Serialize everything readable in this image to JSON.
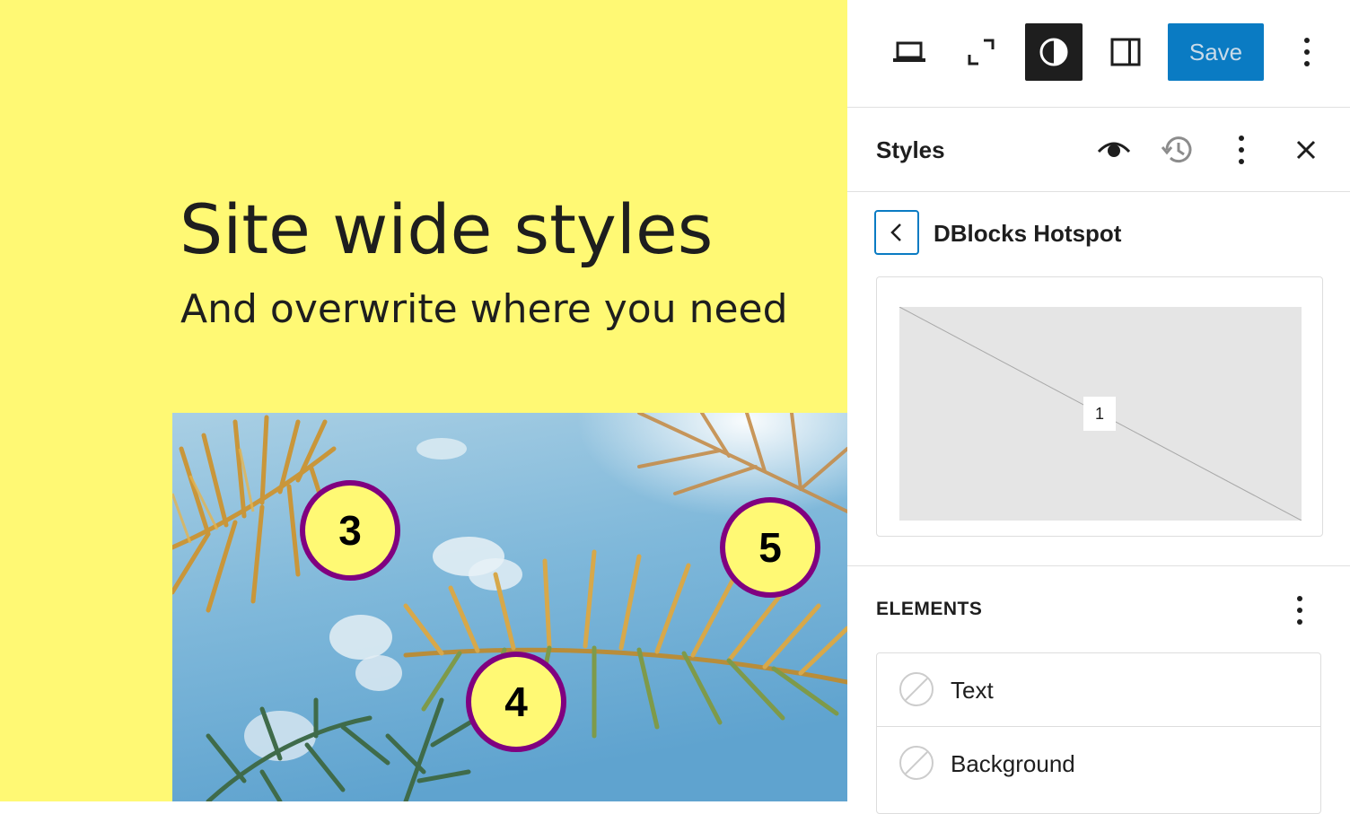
{
  "colors": {
    "canvas_background": "#fff974",
    "hotspot_border": "#800080",
    "save_button": "#0a7bc3",
    "active_toolbar_button": "#1e1e1e"
  },
  "canvas": {
    "title": "Site wide styles",
    "subtitle": "And overwrite where you need",
    "hotspots": [
      {
        "number": "3"
      },
      {
        "number": "4"
      },
      {
        "number": "5"
      }
    ]
  },
  "toolbar": {
    "buttons": [
      {
        "icon": "desktop-preview-icon"
      },
      {
        "icon": "fullscreen-icon"
      },
      {
        "icon": "styles-contrast-icon",
        "active": true
      },
      {
        "icon": "sidebar-toggle-icon"
      }
    ],
    "save_label": "Save",
    "more_icon": "vertical-ellipsis-icon"
  },
  "styles_panel": {
    "title": "Styles",
    "actions": [
      "eye-icon",
      "revisions-icon",
      "vertical-ellipsis-icon",
      "close-icon"
    ],
    "nav_title": "DBlocks Hotspot",
    "back_icon": "chevron-left-icon",
    "preview": {
      "marker_number": "1"
    },
    "elements_heading": "ELEMENTS",
    "elements": [
      {
        "label": "Text",
        "icon": "no-color-swatch-icon"
      },
      {
        "label": "Background",
        "icon": "no-color-swatch-icon"
      }
    ]
  }
}
